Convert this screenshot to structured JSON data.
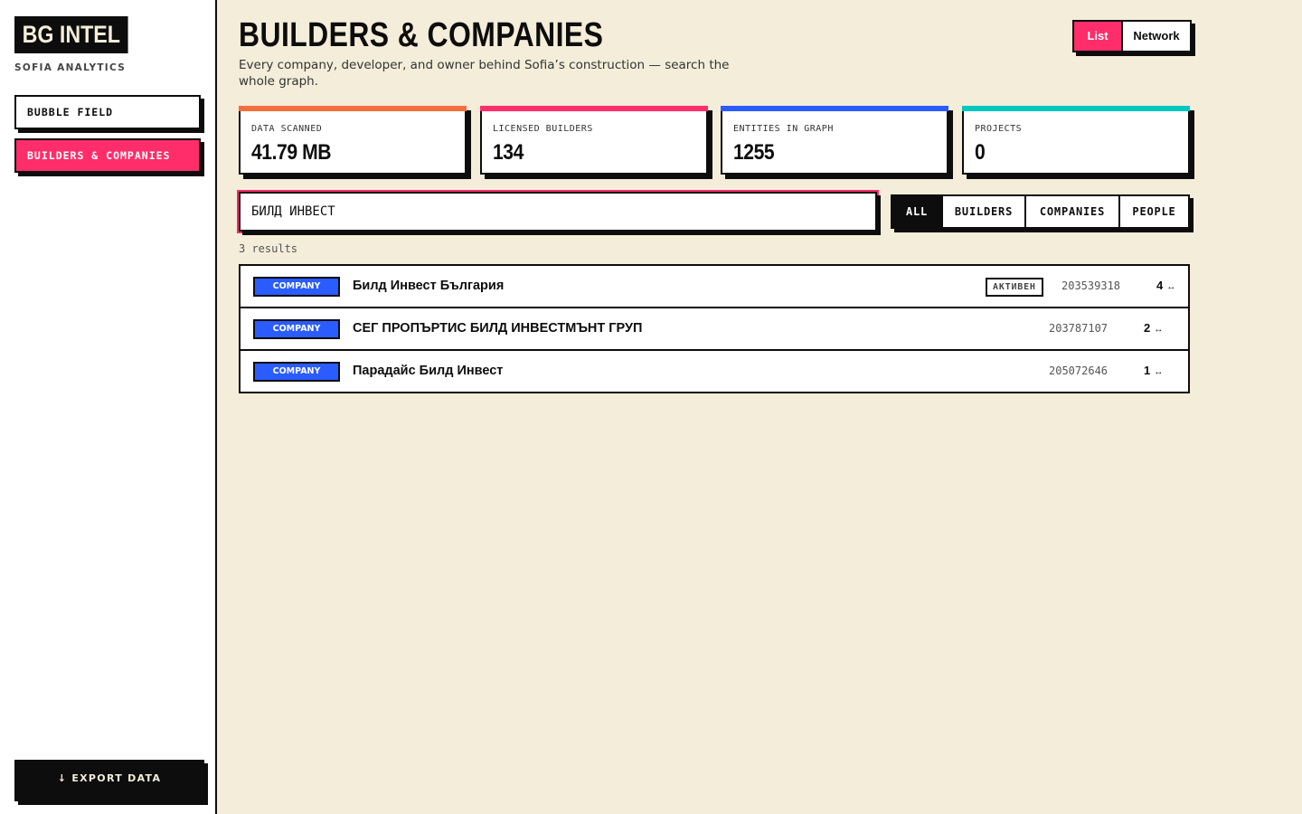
{
  "sidebar": {
    "logo": "BG INTEL",
    "subtitle": "SOFIA ANALYTICS",
    "nav": [
      {
        "label": "BUBBLE FIELD"
      },
      {
        "label": "BUILDERS & COMPANIES"
      }
    ],
    "export_label": "↓ EXPORT DATA"
  },
  "header": {
    "title": "BUILDERS & COMPANIES",
    "subtitle": "Every company, developer, and owner behind Sofia’s construction — search the whole graph.",
    "view_toggle": {
      "list": "List",
      "network": "Network",
      "active": "List"
    }
  },
  "stats": [
    {
      "label": "DATA SCANNED",
      "value": "41.79 MB",
      "color": "#f46f3e"
    },
    {
      "label": "LICENSED BUILDERS",
      "value": "134",
      "color": "#ff2d6a"
    },
    {
      "label": "ENTITIES IN GRAPH",
      "value": "1255",
      "color": "#2a5cff"
    },
    {
      "label": "PROJECTS",
      "value": "0",
      "color": "#00c8c0"
    }
  ],
  "search": {
    "value": "БИЛД ИНВЕСТ"
  },
  "filters": {
    "all": "ALL",
    "builders": "BUILDERS",
    "companies": "COMPANIES",
    "people": "PEOPLE",
    "active": "ALL"
  },
  "results_count": "3 results",
  "results": [
    {
      "type": "COMPANY",
      "name": "Билд Инвест България",
      "status": "АКТИВЕН",
      "eik": "203539318",
      "links": "4",
      "link_icon": "↔"
    },
    {
      "type": "COMPANY",
      "name": "СЕГ ПРОПЪРТИС БИЛД ИНВЕСТМЪНТ ГРУП",
      "status": "",
      "eik": "203787107",
      "links": "2",
      "link_icon": "↔"
    },
    {
      "type": "COMPANY",
      "name": "Парадайс Билд Инвест",
      "status": "",
      "eik": "205072646",
      "links": "1",
      "link_icon": "↔"
    }
  ],
  "colors": {
    "accent": "#ff2d6a",
    "company_badge": "#2a5cff",
    "background": "#f4edd9"
  }
}
